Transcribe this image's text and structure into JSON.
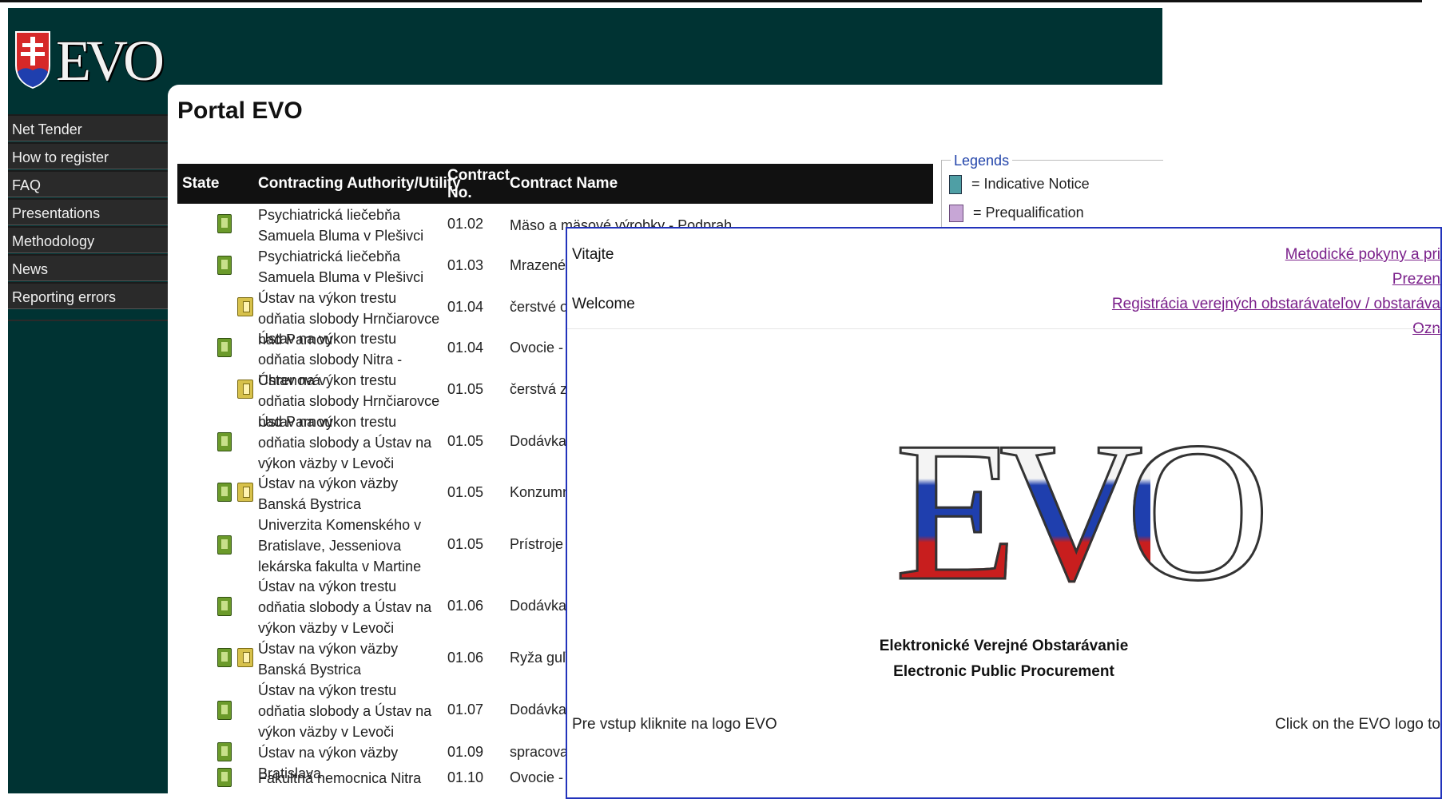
{
  "logo": {
    "text": "EVO"
  },
  "nav": [
    "Net Tender",
    "How to register",
    "FAQ",
    "Presentations",
    "Methodology",
    "News",
    "Reporting errors"
  ],
  "page_title": "Portal EVO",
  "table": {
    "headers": {
      "state": "State",
      "authority": "Contracting Authority/Utility",
      "contract_no": "Contract No.",
      "contract_name": "Contract Name"
    },
    "rows": [
      {
        "authority": "Psychiatrická liečebňa Samuela Bluma v Plešivci",
        "no": "01.02",
        "name": "Mäso a mä",
        "icons": [
          "green"
        ]
      },
      {
        "authority": "Psychiatrická liečebňa Samuela Bluma v Plešivci",
        "no": "01.03",
        "name": "Mrazené v",
        "icons": [
          "green"
        ]
      },
      {
        "authority": "Ústav na výkon trestu odňatia slobody Hrnčiarovce nad Parnou",
        "no": "01.04",
        "name": "čerstvé ov",
        "icons": [
          "yellow"
        ]
      },
      {
        "authority": "Ústav na výkon trestu odňatia slobody Nitra - Chrenová",
        "no": "01.04",
        "name": "Ovocie - z",
        "icons": [
          "green"
        ]
      },
      {
        "authority": "Ústav na výkon trestu odňatia slobody Hrnčiarovce nad Parnou",
        "no": "01.05",
        "name": "čerstvá ze",
        "icons": [
          "yellow"
        ]
      },
      {
        "authority": "Ústav na výkon trestu odňatia slobody a Ústav na výkon väzby v Levoči",
        "no": "01.05",
        "name": "Dodávka b",
        "icons": [
          "green"
        ]
      },
      {
        "authority": "Ústav na výkon väzby Banská Bystrica",
        "no": "01.05",
        "name": "Konzumn",
        "icons": [
          "green",
          "yellow"
        ]
      },
      {
        "authority": "Univerzita Komenského v Bratislave, Jesseniova lekárska fakulta v Martine",
        "no": "01.05",
        "name": "Prístroje p",
        "icons": [
          "green"
        ]
      },
      {
        "authority": "Ústav na výkon trestu odňatia slobody a Ústav na výkon väzby v Levoči",
        "no": "01.06",
        "name": "Dodávka k",
        "icons": [
          "green"
        ]
      },
      {
        "authority": "Ústav na výkon väzby Banská Bystrica",
        "no": "01.06",
        "name": "Ryža guľa",
        "icons": [
          "green",
          "yellow"
        ]
      },
      {
        "authority": "Ústav na výkon trestu odňatia slobody a Ústav na výkon väzby v Levoči",
        "no": "01.07",
        "name": "Dodávka k",
        "icons": [
          "green"
        ]
      },
      {
        "authority": "Ústav na výkon väzby Bratislava",
        "no": "01.09",
        "name": "spracovan",
        "icons": [
          "green"
        ]
      },
      {
        "authority": "Fakultná nemocnica Nitra",
        "no": "01.10",
        "name": "Ovocie - z",
        "icons": [
          "green"
        ]
      }
    ],
    "first_row_full_name": "Mäso a mäsové výrobky - Podprah"
  },
  "legends": {
    "title": "Legends",
    "items": [
      "= Indicative Notice",
      "= Prequalification"
    ]
  },
  "overlay": {
    "welcome_sk": "Vitajte",
    "welcome_en": "Welcome",
    "links": [
      "Metodické pokyny a pri",
      "Prezen",
      "Registrácia verejných obstarávateľov / obstaráva",
      "Ozn"
    ],
    "logo_text": "EVO",
    "caption_sk": "Elektronické Verejné Obstarávanie",
    "caption_en": "Electronic Public Procurement",
    "note_left": "Pre vstup kliknite na logo EVO",
    "note_right": "Click on the EVO logo to"
  },
  "colors": {
    "frame": "#003333",
    "nav_bg": "#2a2a2a",
    "link": "#7a1f8a",
    "overlay_border": "#2233bb"
  }
}
